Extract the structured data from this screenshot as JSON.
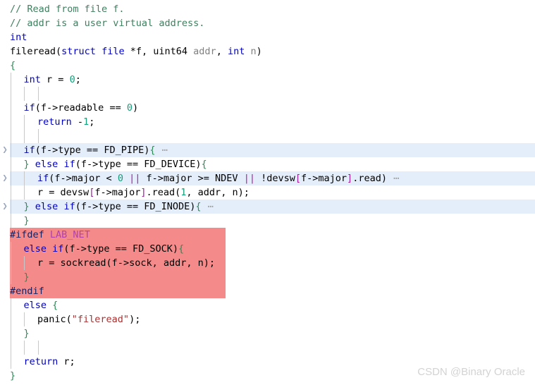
{
  "editor": {
    "language": "c",
    "colors": {
      "background": "#ffffff",
      "selection_blue": "#e4eefb",
      "highlight_red": "#f58a8a",
      "comment": "#3f7f5f",
      "keyword": "#0000c0",
      "number": "#169e7a",
      "string": "#a83232",
      "parameter": "#808080",
      "preprocessor": "#16205e",
      "macro_name": "#b040b0",
      "bracket": "#a020a0",
      "brace": "#2e8b57",
      "fold_ellipsis": "#9b9b9b",
      "indent_guide": "#c8c8c8",
      "fold_arrow": "#9aa7bd"
    },
    "fold_ellipsis": "⋯",
    "fold_arrow_icon": "❯",
    "lines": [
      {
        "n": 1,
        "indent": 0,
        "fold": false,
        "hl": "none",
        "tokens": [
          {
            "t": "// Read from file f.",
            "c": "cmt"
          }
        ]
      },
      {
        "n": 2,
        "indent": 0,
        "fold": false,
        "hl": "none",
        "tokens": [
          {
            "t": "// addr is a user virtual address.",
            "c": "cmt"
          }
        ]
      },
      {
        "n": 3,
        "indent": 0,
        "fold": false,
        "hl": "none",
        "tokens": [
          {
            "t": "int",
            "c": "typ"
          }
        ]
      },
      {
        "n": 4,
        "indent": 0,
        "fold": false,
        "hl": "none",
        "tokens": [
          {
            "t": "fileread",
            "c": "id"
          },
          {
            "t": "(",
            "c": "op"
          },
          {
            "t": "struct",
            "c": "kw"
          },
          {
            "t": " ",
            "c": "op"
          },
          {
            "t": "file",
            "c": "kw"
          },
          {
            "t": " *f, ",
            "c": "op"
          },
          {
            "t": "uint64",
            "c": "id"
          },
          {
            "t": " ",
            "c": "op"
          },
          {
            "t": "addr",
            "c": "prm"
          },
          {
            "t": ", ",
            "c": "op"
          },
          {
            "t": "int",
            "c": "kw"
          },
          {
            "t": " ",
            "c": "op"
          },
          {
            "t": "n",
            "c": "prm"
          },
          {
            "t": ")",
            "c": "op"
          }
        ]
      },
      {
        "n": 5,
        "indent": 0,
        "fold": false,
        "hl": "none",
        "tokens": [
          {
            "t": "{",
            "c": "brc"
          }
        ]
      },
      {
        "n": 6,
        "indent": 1,
        "fold": false,
        "hl": "none",
        "tokens": [
          {
            "t": "int",
            "c": "kw"
          },
          {
            "t": " r ",
            "c": "op"
          },
          {
            "t": "=",
            "c": "op"
          },
          {
            "t": " ",
            "c": "op"
          },
          {
            "t": "0",
            "c": "num"
          },
          {
            "t": ";",
            "c": "op"
          }
        ]
      },
      {
        "n": 7,
        "indent": 1,
        "fold": false,
        "hl": "none",
        "tokens": []
      },
      {
        "n": 8,
        "indent": 1,
        "fold": false,
        "hl": "none",
        "tokens": [
          {
            "t": "if",
            "c": "kw"
          },
          {
            "t": "(f->readable ",
            "c": "op"
          },
          {
            "t": "==",
            "c": "op"
          },
          {
            "t": " ",
            "c": "op"
          },
          {
            "t": "0",
            "c": "num"
          },
          {
            "t": ")",
            "c": "op"
          }
        ]
      },
      {
        "n": 9,
        "indent": 2,
        "fold": false,
        "hl": "none",
        "tokens": [
          {
            "t": "return",
            "c": "kw"
          },
          {
            "t": " -",
            "c": "op"
          },
          {
            "t": "1",
            "c": "num"
          },
          {
            "t": ";",
            "c": "op"
          }
        ]
      },
      {
        "n": 10,
        "indent": 1,
        "fold": false,
        "hl": "none",
        "tokens": []
      },
      {
        "n": 11,
        "indent": 1,
        "fold": true,
        "hl": "blue",
        "tokens": [
          {
            "t": "if",
            "c": "kw"
          },
          {
            "t": "(f->type ",
            "c": "op"
          },
          {
            "t": "==",
            "c": "op"
          },
          {
            "t": " FD_PIPE)",
            "c": "op"
          },
          {
            "t": "{",
            "c": "brc"
          },
          {
            "t": " ⋯",
            "c": "ell"
          }
        ]
      },
      {
        "n": 12,
        "indent": 1,
        "fold": false,
        "hl": "none",
        "tokens": [
          {
            "t": "}",
            "c": "brc"
          },
          {
            "t": " ",
            "c": "op"
          },
          {
            "t": "else",
            "c": "kw"
          },
          {
            "t": " ",
            "c": "op"
          },
          {
            "t": "if",
            "c": "kw"
          },
          {
            "t": "(f->type ",
            "c": "op"
          },
          {
            "t": "==",
            "c": "op"
          },
          {
            "t": " FD_DEVICE)",
            "c": "op"
          },
          {
            "t": "{",
            "c": "brc"
          }
        ]
      },
      {
        "n": 13,
        "indent": 2,
        "fold": true,
        "hl": "blue",
        "tokens": [
          {
            "t": "if",
            "c": "kw"
          },
          {
            "t": "(f->major ",
            "c": "op"
          },
          {
            "t": "<",
            "c": "op"
          },
          {
            "t": " ",
            "c": "op"
          },
          {
            "t": "0",
            "c": "num"
          },
          {
            "t": " ",
            "c": "op"
          },
          {
            "t": "||",
            "c": "brk"
          },
          {
            "t": " f->major ",
            "c": "op"
          },
          {
            "t": ">=",
            "c": "op"
          },
          {
            "t": " NDEV ",
            "c": "op"
          },
          {
            "t": "||",
            "c": "brk"
          },
          {
            "t": " !devsw",
            "c": "op"
          },
          {
            "t": "[",
            "c": "brk"
          },
          {
            "t": "f->major",
            "c": "op"
          },
          {
            "t": "]",
            "c": "brk"
          },
          {
            "t": ".read)",
            "c": "op"
          },
          {
            "t": " ⋯",
            "c": "ell"
          }
        ]
      },
      {
        "n": 14,
        "indent": 2,
        "fold": false,
        "hl": "none",
        "tokens": [
          {
            "t": "r ",
            "c": "op"
          },
          {
            "t": "=",
            "c": "op"
          },
          {
            "t": " devsw",
            "c": "op"
          },
          {
            "t": "[",
            "c": "brk"
          },
          {
            "t": "f->major",
            "c": "op"
          },
          {
            "t": "]",
            "c": "brk"
          },
          {
            "t": ".read(",
            "c": "op"
          },
          {
            "t": "1",
            "c": "num"
          },
          {
            "t": ", addr, n);",
            "c": "op"
          }
        ]
      },
      {
        "n": 15,
        "indent": 1,
        "fold": true,
        "hl": "blue",
        "tokens": [
          {
            "t": "}",
            "c": "brc"
          },
          {
            "t": " ",
            "c": "op"
          },
          {
            "t": "else",
            "c": "kw"
          },
          {
            "t": " ",
            "c": "op"
          },
          {
            "t": "if",
            "c": "kw"
          },
          {
            "t": "(f->type ",
            "c": "op"
          },
          {
            "t": "==",
            "c": "op"
          },
          {
            "t": " FD_INODE)",
            "c": "op"
          },
          {
            "t": "{",
            "c": "brc"
          },
          {
            "t": " ⋯",
            "c": "ell"
          }
        ]
      },
      {
        "n": 16,
        "indent": 1,
        "fold": false,
        "hl": "none",
        "tokens": [
          {
            "t": "}",
            "c": "brc"
          }
        ]
      },
      {
        "n": 17,
        "indent": 0,
        "fold": false,
        "hl": "red",
        "tokens": [
          {
            "t": "#ifdef",
            "c": "pp"
          },
          {
            "t": " ",
            "c": "op"
          },
          {
            "t": "LAB_NET",
            "c": "mac"
          }
        ]
      },
      {
        "n": 18,
        "indent": 1,
        "fold": false,
        "hl": "red",
        "tokens": [
          {
            "t": "else",
            "c": "kw"
          },
          {
            "t": " ",
            "c": "op"
          },
          {
            "t": "if",
            "c": "kw"
          },
          {
            "t": "(f->type ",
            "c": "op"
          },
          {
            "t": "==",
            "c": "op"
          },
          {
            "t": " FD_SOCK)",
            "c": "op"
          },
          {
            "t": "{",
            "c": "brc"
          }
        ]
      },
      {
        "n": 19,
        "indent": 2,
        "fold": false,
        "hl": "red",
        "tokens": [
          {
            "t": "r ",
            "c": "op"
          },
          {
            "t": "=",
            "c": "op"
          },
          {
            "t": " sockread(f->sock, addr, n);",
            "c": "op"
          }
        ]
      },
      {
        "n": 20,
        "indent": 1,
        "fold": false,
        "hl": "red",
        "tokens": [
          {
            "t": "}",
            "c": "brc"
          }
        ]
      },
      {
        "n": 21,
        "indent": 0,
        "fold": false,
        "hl": "red",
        "tokens": [
          {
            "t": "#endif",
            "c": "pp"
          }
        ]
      },
      {
        "n": 22,
        "indent": 1,
        "fold": false,
        "hl": "none",
        "tokens": [
          {
            "t": "else",
            "c": "kw"
          },
          {
            "t": " ",
            "c": "op"
          },
          {
            "t": "{",
            "c": "brc"
          }
        ]
      },
      {
        "n": 23,
        "indent": 2,
        "fold": false,
        "hl": "none",
        "tokens": [
          {
            "t": "panic(",
            "c": "op"
          },
          {
            "t": "\"fileread\"",
            "c": "str"
          },
          {
            "t": ");",
            "c": "op"
          }
        ]
      },
      {
        "n": 24,
        "indent": 1,
        "fold": false,
        "hl": "none",
        "tokens": [
          {
            "t": "}",
            "c": "brc"
          }
        ]
      },
      {
        "n": 25,
        "indent": 1,
        "fold": false,
        "hl": "none",
        "tokens": []
      },
      {
        "n": 26,
        "indent": 1,
        "fold": false,
        "hl": "none",
        "tokens": [
          {
            "t": "return",
            "c": "kw"
          },
          {
            "t": " r;",
            "c": "op"
          }
        ]
      },
      {
        "n": 27,
        "indent": 0,
        "fold": false,
        "hl": "none",
        "tokens": [
          {
            "t": "}",
            "c": "brc"
          }
        ]
      }
    ]
  },
  "watermark": {
    "text": "CSDN @Binary Oracle"
  }
}
